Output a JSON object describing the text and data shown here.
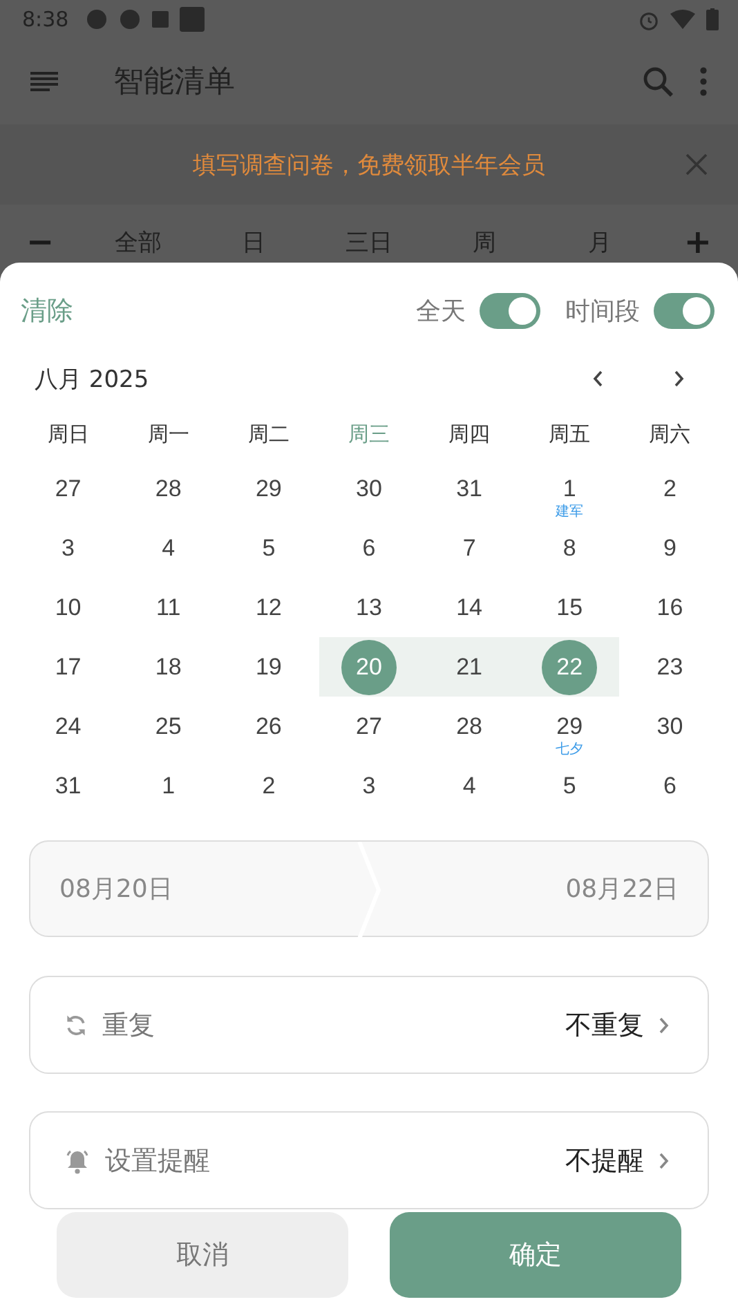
{
  "status_bar": {
    "time": "8:38"
  },
  "app_bar": {
    "title": "智能清单"
  },
  "banner": {
    "text": "填写调查问卷，免费领取半年会员"
  },
  "view_tabs": {
    "minus": "−",
    "plus": "+",
    "tabs": [
      {
        "label": "全部",
        "selected": false
      },
      {
        "label": "日",
        "selected": false
      },
      {
        "label": "三日",
        "selected": false
      },
      {
        "label": "周",
        "selected": false
      },
      {
        "label": "月",
        "selected": false
      }
    ]
  },
  "sheet": {
    "clear": "清除",
    "toggles": [
      {
        "label": "全天",
        "on": true
      },
      {
        "label": "时间段",
        "on": true
      }
    ],
    "month": "八月 2025",
    "weekdays": [
      {
        "label": "周日",
        "today": false
      },
      {
        "label": "周一",
        "today": false
      },
      {
        "label": "周二",
        "today": false
      },
      {
        "label": "周三",
        "today": true
      },
      {
        "label": "周四",
        "today": false
      },
      {
        "label": "周五",
        "today": false
      },
      {
        "label": "周六",
        "today": false
      }
    ],
    "days": [
      {
        "label": "27",
        "selected": false,
        "in_range": false
      },
      {
        "label": "28",
        "selected": false,
        "in_range": false
      },
      {
        "label": "29",
        "selected": false,
        "in_range": false
      },
      {
        "label": "30",
        "selected": false,
        "in_range": false
      },
      {
        "label": "31",
        "selected": false,
        "in_range": false
      },
      {
        "label": "1",
        "note": "建军",
        "selected": false,
        "in_range": false
      },
      {
        "label": "2",
        "selected": false,
        "in_range": false
      },
      {
        "label": "3",
        "selected": false,
        "in_range": false
      },
      {
        "label": "4",
        "selected": false,
        "in_range": false
      },
      {
        "label": "5",
        "selected": false,
        "in_range": false
      },
      {
        "label": "6",
        "selected": false,
        "in_range": false
      },
      {
        "label": "7",
        "selected": false,
        "in_range": false
      },
      {
        "label": "8",
        "selected": false,
        "in_range": false
      },
      {
        "label": "9",
        "selected": false,
        "in_range": false
      },
      {
        "label": "10",
        "selected": false,
        "in_range": false
      },
      {
        "label": "11",
        "selected": false,
        "in_range": false
      },
      {
        "label": "12",
        "selected": false,
        "in_range": false
      },
      {
        "label": "13",
        "selected": false,
        "in_range": false
      },
      {
        "label": "14",
        "selected": false,
        "in_range": false
      },
      {
        "label": "15",
        "selected": false,
        "in_range": false
      },
      {
        "label": "16",
        "selected": false,
        "in_range": false
      },
      {
        "label": "17",
        "selected": false,
        "in_range": false
      },
      {
        "label": "18",
        "selected": false,
        "in_range": false
      },
      {
        "label": "19",
        "selected": false,
        "in_range": false
      },
      {
        "label": "20",
        "selected": true,
        "in_range": true
      },
      {
        "label": "21",
        "selected": false,
        "in_range": true
      },
      {
        "label": "22",
        "selected": true,
        "in_range": true
      },
      {
        "label": "23",
        "selected": false,
        "in_range": false
      },
      {
        "label": "24",
        "selected": false,
        "in_range": false
      },
      {
        "label": "25",
        "selected": false,
        "in_range": false
      },
      {
        "label": "26",
        "selected": false,
        "in_range": false
      },
      {
        "label": "27",
        "selected": false,
        "in_range": false
      },
      {
        "label": "28",
        "selected": false,
        "in_range": false
      },
      {
        "label": "29",
        "note": "七夕",
        "selected": false,
        "in_range": false
      },
      {
        "label": "30",
        "selected": false,
        "in_range": false
      },
      {
        "label": "31",
        "selected": false,
        "in_range": false
      },
      {
        "label": "1",
        "selected": false,
        "in_range": false
      },
      {
        "label": "2",
        "selected": false,
        "in_range": false
      },
      {
        "label": "3",
        "selected": false,
        "in_range": false
      },
      {
        "label": "4",
        "selected": false,
        "in_range": false
      },
      {
        "label": "5",
        "selected": false,
        "in_range": false
      },
      {
        "label": "6",
        "selected": false,
        "in_range": false
      }
    ],
    "range": {
      "start": "08月20日",
      "end": "08月22日"
    },
    "options": [
      {
        "kind": "repeat",
        "label": "重复",
        "value": "不重复"
      },
      {
        "kind": "reminder",
        "label": "设置提醒",
        "value": "不提醒"
      }
    ],
    "buttons": {
      "cancel": "取消",
      "confirm": "确定"
    }
  }
}
